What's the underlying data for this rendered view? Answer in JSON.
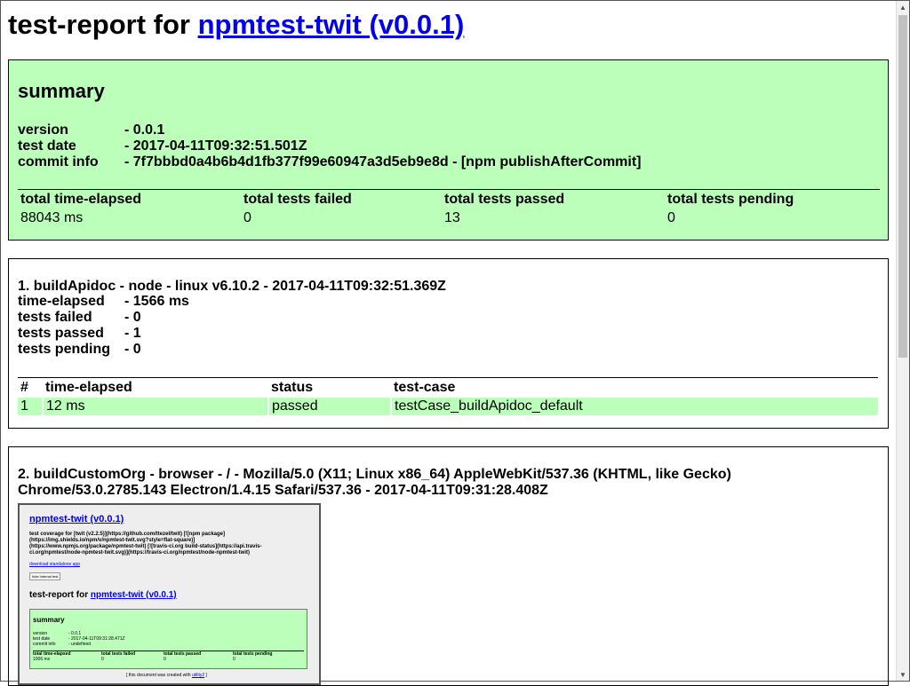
{
  "header": {
    "title_prefix": "test-report for",
    "link_text": "npmtest-twit (v0.0.1)"
  },
  "summary": {
    "heading": "summary",
    "rows": [
      {
        "label": "version",
        "value": "- 0.0.1"
      },
      {
        "label": "test date",
        "value": "- 2017-04-11T09:32:51.501Z"
      },
      {
        "label": "commit info",
        "value": "- 7f7bbbd0a4b6b4d1fb377f99e60947a3d5eb9e8d - [npm publishAfterCommit]"
      }
    ],
    "table_headers": [
      "total time-elapsed",
      "total tests failed",
      "total tests passed",
      "total tests pending"
    ],
    "table_values": [
      "88043 ms",
      "0",
      "13",
      "0"
    ]
  },
  "section1": {
    "title": "1. buildApidoc - node - linux v6.10.2 - 2017-04-11T09:32:51.369Z",
    "rows": [
      {
        "label": "time-elapsed",
        "value": "- 1566 ms"
      },
      {
        "label": "tests failed",
        "value": "- 0"
      },
      {
        "label": "tests passed",
        "value": "- 1"
      },
      {
        "label": "tests pending",
        "value": "- 0"
      }
    ],
    "table_headers": [
      "#",
      "time-elapsed",
      "status",
      "test-case"
    ],
    "cases": [
      {
        "num": "1",
        "time": "12 ms",
        "status": "passed",
        "name": "testCase_buildApidoc_default"
      }
    ]
  },
  "section2": {
    "title_line1": "2. buildCustomOrg - browser - / - Mozilla/5.0 (X11; Linux x86_64) AppleWebKit/537.36 (KHTML, like Gecko)",
    "title_line2": "Chrome/53.0.2785.143 Electron/1.4.15 Safari/537.36 - 2017-04-11T09:31:28.408Z",
    "screenshot": {
      "link": "npmtest-twit (v0.0.1)",
      "coverage_line1": "test coverage for [twit (v2.2.5)](https://github.com/ttezel/twit) [![npm package]",
      "coverage_line2": "(https://img.shields.io/npm/v/npmtest-twit.svg?style=flat-square)]",
      "coverage_line3": "(https://www.npmjs.org/package/npmtest-twit) [![travis-ci.org build-status](https://api.travis-",
      "coverage_line4": "ci.org/npmtest/node-npmtest-twit.svg)](https://travis-ci.org/npmtest/node-npmtest-twit)",
      "download": "download standalone app",
      "button": "hide internal test",
      "report_prefix": "test-report for",
      "report_link": "npmtest-twit (v0.0.1)",
      "summary": "summary",
      "rows": [
        {
          "label": "version",
          "value": "- 0.0.1"
        },
        {
          "label": "test date",
          "value": "- 2017-04-11T09:31:28.471Z"
        },
        {
          "label": "commit info",
          "value": "- undefined"
        }
      ],
      "table_headers": [
        "total time-elapsed",
        "total tests failed",
        "total tests passed",
        "total tests pending"
      ],
      "table_values": [
        "1006 ms",
        "0",
        "0",
        "0"
      ],
      "footer_prefix": "[ this document was created with ",
      "footer_link": "utility2",
      "footer_suffix": " ]"
    }
  },
  "colors": {
    "pass_green": "#bbffbb",
    "link": "#0000ee"
  },
  "icons": {
    "scroll_up": "triangle-up",
    "scroll_down": "triangle-down"
  }
}
